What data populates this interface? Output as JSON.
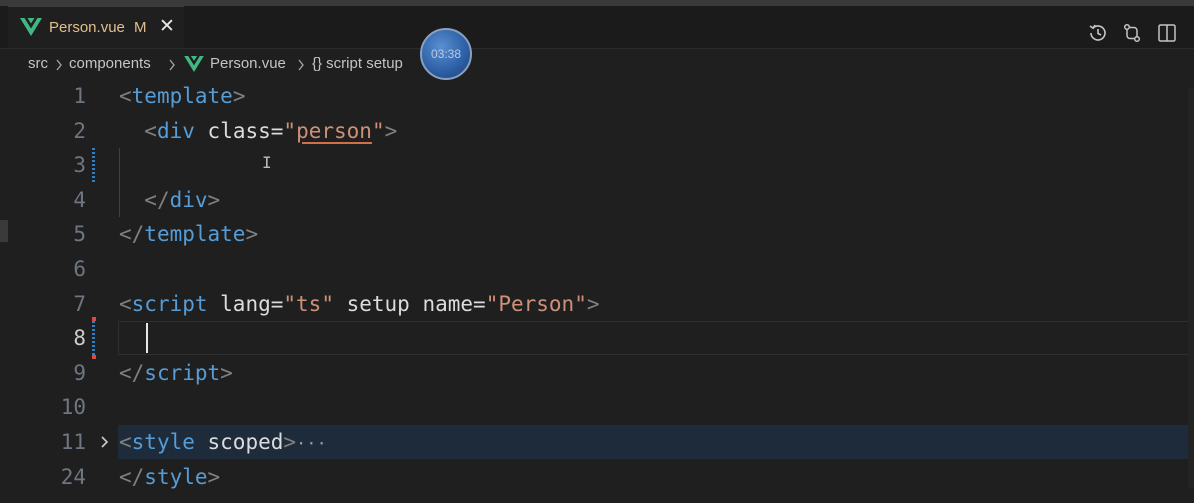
{
  "tab": {
    "filename": "Person.vue",
    "status": "M",
    "close_glyph": "✕"
  },
  "toolbar": {
    "icons": [
      "history-icon",
      "source-control-compare-icon",
      "split-editor-icon"
    ]
  },
  "breadcrumb": {
    "items": [
      "src",
      "components",
      "Person.vue",
      "{} script setup"
    ]
  },
  "overlay": {
    "timer": "03:38"
  },
  "colors": {
    "modified": "#e2c08d",
    "vue_green": "#41b883",
    "tag": "#569cd6",
    "string": "#ce9178"
  },
  "editor": {
    "line_numbers": [
      "1",
      "2",
      "3",
      "4",
      "5",
      "6",
      "7",
      "8",
      "9",
      "10",
      "11",
      "24"
    ],
    "current_line": "8",
    "folded_line": "11",
    "lines": {
      "l1": {
        "open": "<",
        "tag": "template",
        "close": ">"
      },
      "l2": {
        "indent": "  ",
        "open": "<",
        "tag": "div",
        "sp": " ",
        "attr": "class",
        "eq": "=",
        "q1": "\"",
        "val": "person",
        "q2": "\"",
        "close": ">"
      },
      "l4": {
        "indent": "  ",
        "open": "</",
        "tag": "div",
        "close": ">"
      },
      "l5": {
        "open": "</",
        "tag": "template",
        "close": ">"
      },
      "l7": {
        "open": "<",
        "tag": "script",
        "a1": " lang",
        "eq1": "=",
        "v1": "\"ts\"",
        "a2": " setup",
        "a3": " name",
        "eq3": "=",
        "v3": "\"Person\"",
        "close": ">"
      },
      "l9": {
        "open": "</",
        "tag": "script",
        "close": ">"
      },
      "l11": {
        "open": "<",
        "tag": "style",
        "attr": " scoped",
        "close": ">",
        "ellipsis": "···"
      },
      "l24": {
        "open": "</",
        "tag": "style",
        "close": ">"
      }
    }
  }
}
